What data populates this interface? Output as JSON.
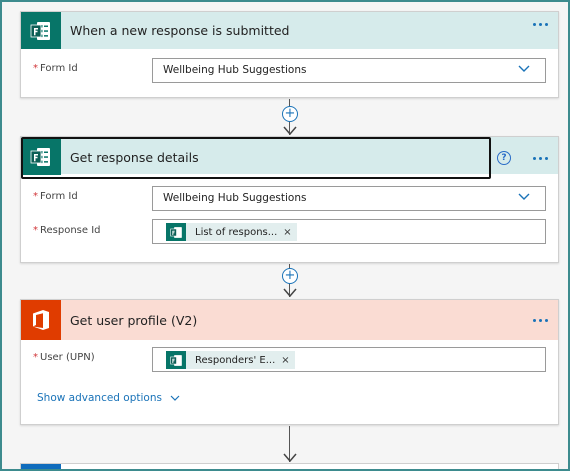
{
  "steps": [
    {
      "title": "When a new response is submitted",
      "fields": [
        {
          "label": "Form Id",
          "required_mark": "*",
          "value": "Wellbeing Hub Suggestions"
        }
      ],
      "icon": "forms-icon",
      "header_color": "#d6ebeb"
    },
    {
      "title": "Get response details",
      "fields": [
        {
          "label": "Form Id",
          "required_mark": "*",
          "value": "Wellbeing Hub Suggestions"
        },
        {
          "label": "Response Id",
          "required_mark": "*",
          "token": "List of respons...",
          "token_remove": "×"
        }
      ],
      "icon": "forms-icon",
      "help": "?",
      "header_color": "#d6ebeb"
    },
    {
      "title": "Get user profile (V2)",
      "fields": [
        {
          "label": "User (UPN)",
          "required_mark": "*",
          "token": "Responders' E...",
          "token_remove": "×"
        }
      ],
      "advanced_link": "Show advanced options",
      "icon": "office-icon",
      "header_color": "#fadcd3"
    }
  ],
  "connectors": {
    "add_step_symbol": "+"
  },
  "colors": {
    "accent": "#1a73b8",
    "forms_green": "#077568",
    "office_red": "#e03c00"
  }
}
